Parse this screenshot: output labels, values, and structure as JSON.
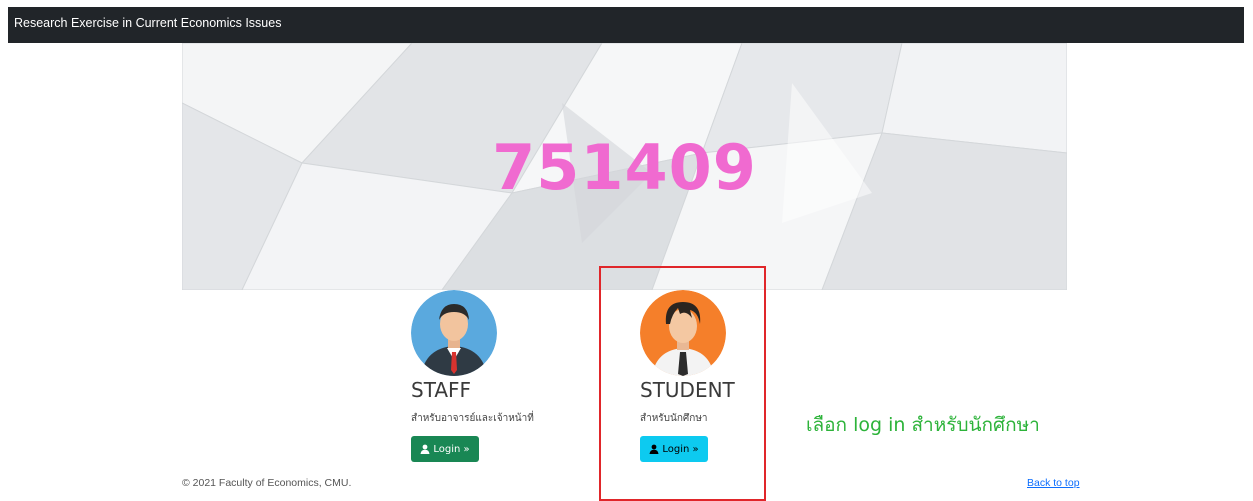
{
  "navbar": {
    "brand": "Research Exercise in Current Economics Issues"
  },
  "hero": {
    "course_code": "751409"
  },
  "cards": [
    {
      "role": "STAFF",
      "description": "สำหรับอาจารย์และเจ้าหน้าที่",
      "button_label": "Login »",
      "button_color": "#198754",
      "avatar_bg": "#5aa9de"
    },
    {
      "role": "STUDENT",
      "description": "สำหรับนักศึกษา",
      "button_label": "Login »",
      "button_color": "#0dcaf0",
      "avatar_bg": "#f57f2a"
    }
  ],
  "annotation": {
    "text": "เลือก log in สำหรับนักศึกษา",
    "color": "#2db33a",
    "box_color": "#e0262a"
  },
  "footer": {
    "copyright": "© 2021 Faculty of Economics, CMU.",
    "back_to_top": "Back to top"
  }
}
